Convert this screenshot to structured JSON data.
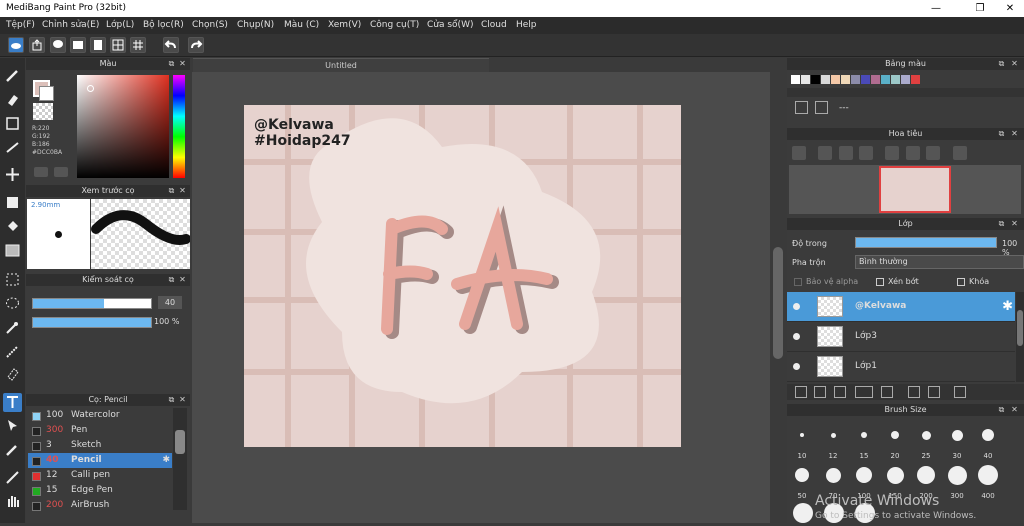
{
  "window": {
    "title": "MediBang Paint Pro (32bit)",
    "min": "—",
    "max": "❐",
    "close": "✕"
  },
  "menu": [
    "Tệp(F)",
    "Chỉnh sửa(E)",
    "Lớp(L)",
    "Bộ lọc(R)",
    "Chọn(S)",
    "Chụp(N)",
    "Màu (C)",
    "Xem(V)",
    "Công cụ(T)",
    "Cửa sổ(W)",
    "Cloud",
    "Help"
  ],
  "toolbar_icons": [
    "cloud-icon",
    "share-icon",
    "comment-icon",
    "comic-icon",
    "page-icon",
    "panel-icon",
    "grid-icon",
    "undo-icon",
    "redo-icon"
  ],
  "tools": [
    "brush-icon",
    "eraser-icon",
    "rect-icon",
    "line-icon",
    "move-icon",
    "fill-rect-icon",
    "bucket-icon",
    "gradient-icon",
    "select-rect-icon",
    "lasso-icon",
    "magic-wand-icon",
    "select-pen-icon",
    "select-eraser-icon",
    "text-icon",
    "operation-icon",
    "dropper-icon",
    "pen-icon",
    "hand-icon"
  ],
  "color_panel": {
    "title": "Màu",
    "fg": "#DCC0BA",
    "r": "R:220",
    "g": "G:192",
    "b": "B:186",
    "hex": "#DCC0BA"
  },
  "preview_panel": {
    "title": "Xem trước cọ",
    "size": "2.90mm"
  },
  "brush_control": {
    "title": "Kiểm soát cọ",
    "size_value": "40",
    "opacity_value": "100 %",
    "size_fill": 0.6,
    "opacity_fill": 1.0
  },
  "brush_list": {
    "title": "Cọ: Pencil",
    "items": [
      {
        "num": "100",
        "label": "Watercolor",
        "color": "#8fd3f5"
      },
      {
        "num": "300",
        "label": "Pen",
        "color": "#222222",
        "num_color": "#e05050"
      },
      {
        "num": "3",
        "label": "Sketch",
        "color": "#222222"
      },
      {
        "num": "40",
        "label": "Pencil",
        "color": "#222222",
        "num_color": "#e05050",
        "active": true
      },
      {
        "num": "12",
        "label": "Calli pen",
        "color": "#e03030"
      },
      {
        "num": "15",
        "label": "Edge Pen",
        "color": "#22aa22"
      },
      {
        "num": "200",
        "label": "AirBrush",
        "color": "#222222",
        "num_color": "#e05050"
      }
    ]
  },
  "document": {
    "tab": "Untitled",
    "text_line1": "@Kelvawa",
    "text_line2": "#Hoidap247",
    "logo": "FA"
  },
  "palette_panel": {
    "title": "Bảng màu",
    "dash": "---",
    "swatches": [
      "#ffffff",
      "#e8e8e8",
      "#000000",
      "#d9d9d9",
      "#f5c9a8",
      "#f0d8b8",
      "#8c8caa",
      "#4a4ab8",
      "#b06c90",
      "#5ab0c8",
      "#9cc8c8",
      "#aaaacc",
      "#e04040"
    ]
  },
  "navigator_panel": {
    "title": "Hoa tiêu"
  },
  "layer_panel": {
    "title": "Lớp",
    "opacity_label": "Độ trong",
    "opacity_value": "100 %",
    "blend_label": "Pha trộn",
    "blend_value": "Bình thường",
    "protect_alpha": "Bảo vệ alpha",
    "clipping": "Xén bớt",
    "lock": "Khóa",
    "layers": [
      {
        "name": "@Kelvawa",
        "active": true
      },
      {
        "name": "Lớp3",
        "active": false
      },
      {
        "name": "Lớp1",
        "active": false
      }
    ]
  },
  "brush_size_panel": {
    "title": "Brush Size",
    "sizes": [
      "10",
      "12",
      "15",
      "20",
      "25",
      "30",
      "40",
      "50",
      "70",
      "100",
      "150",
      "200",
      "300",
      "400"
    ]
  },
  "watermark": {
    "line1": "Activate Windows",
    "line2": "Go to Settings to activate Windows."
  }
}
